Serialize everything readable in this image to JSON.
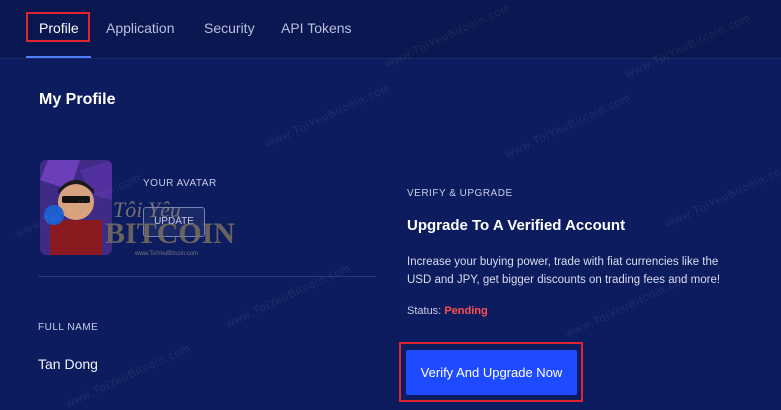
{
  "tabs": [
    {
      "label": "Profile",
      "active": true
    },
    {
      "label": "Application",
      "active": false
    },
    {
      "label": "Security",
      "active": false
    },
    {
      "label": "API Tokens",
      "active": false
    }
  ],
  "page_title": "My Profile",
  "avatar": {
    "caption": "YOUR AVATAR",
    "update_label": "UPDATE"
  },
  "full_name": {
    "label": "FULL NAME",
    "value": "Tan Dong"
  },
  "verify": {
    "section_label": "VERIFY & UPGRADE",
    "heading": "Upgrade To A Verified Account",
    "description": "Increase your buying power, trade with fiat currencies like the USD and JPY, get bigger discounts on trading fees and more!",
    "status_label": "Status:",
    "status_value": "Pending",
    "button_label": "Verify And Upgrade Now"
  },
  "watermark": {
    "logo_line1": "Tôi Yêu",
    "logo_line2": "BITCOIN",
    "logo_url": "www.ToiYeuBitcoin.com",
    "repeat_text": "www.ToiYeuBitcoin.com"
  },
  "colors": {
    "background": "#0d1c5e",
    "accent": "#1e4bff",
    "highlight": "#e0252f",
    "status_pending": "#ff4d4f"
  }
}
